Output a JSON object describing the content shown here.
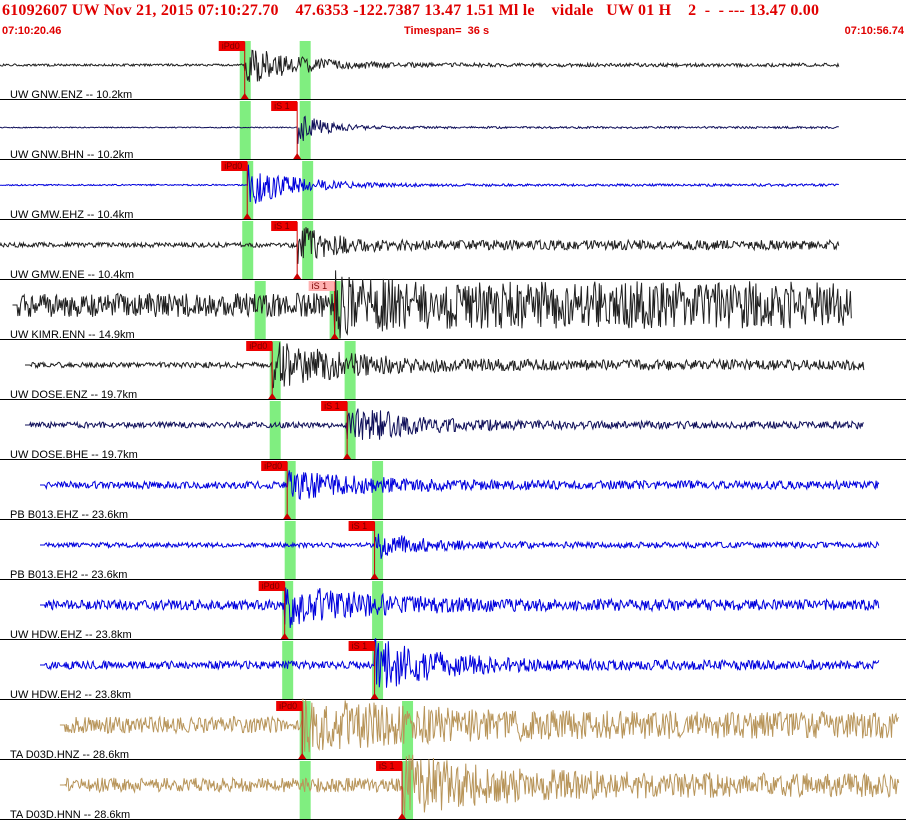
{
  "header": {
    "title": "61092607 UW Nov 21, 2015 07:10:27.70    47.6353 -122.7387 13.47 1.51 Ml le    vidale   UW 01 H    2  -  - --- 13.47 0.00",
    "start_time": "07:10:20.46",
    "timespan": "Timespan=  36 s",
    "end_time": "07:10:56.74"
  },
  "colors": {
    "header_text": "#e00000",
    "pick_flag": "#ee0000",
    "pick_flag_light": "#ffb0b0",
    "pick_window": "#80ee80",
    "trace_black": "#202020",
    "trace_navy": "#10105a",
    "trace_blue": "#0000dd",
    "trace_tan": "#b8955a"
  },
  "time_axis": {
    "start_s": 0,
    "end_s": 36.28
  },
  "traces": [
    {
      "label": "UW GNW.ENZ -- 10.2km",
      "color": "trace_black",
      "start_s": 0,
      "end_s": 33.6,
      "noise": 0.03,
      "pre_amp": 0.05,
      "amp": 0.9,
      "onset_s": 9.8,
      "decay": 6,
      "gain": 0.18,
      "seed": 1,
      "picks": [
        {
          "label": "iPd0",
          "time_s": 9.8,
          "light": false
        }
      ],
      "windows": [
        9.6,
        12.0
      ]
    },
    {
      "label": "UW GNW.BHN -- 10.2km",
      "color": "trace_navy",
      "start_s": 0,
      "end_s": 33.6,
      "noise": 0.02,
      "pre_amp": 0.02,
      "amp": 0.6,
      "onset_s": 11.9,
      "decay": 3,
      "gain": 0.22,
      "seed": 2,
      "offset": 0.25,
      "picks": [
        {
          "label": "iS 1",
          "time_s": 11.9,
          "light": false
        }
      ],
      "windows": [
        9.6,
        12.0
      ]
    },
    {
      "label": "UW GMW.EHZ -- 10.4km",
      "color": "trace_blue",
      "start_s": 0,
      "end_s": 33.6,
      "noise": 0.02,
      "pre_amp": 0.03,
      "amp": 0.9,
      "onset_s": 9.9,
      "decay": 5,
      "gain": 0.2,
      "seed": 3,
      "picks": [
        {
          "label": "iPd0",
          "time_s": 9.9,
          "light": false
        }
      ],
      "windows": [
        9.7,
        12.1
      ]
    },
    {
      "label": "UW GMW.ENE -- 10.4km",
      "color": "trace_black",
      "start_s": 0,
      "end_s": 33.6,
      "noise": 0.1,
      "pre_amp": 0.1,
      "amp": 0.7,
      "onset_s": 11.9,
      "decay": 4,
      "gain": 0.2,
      "seed": 4,
      "picks": [
        {
          "label": "iS 1",
          "time_s": 11.9,
          "light": false
        }
      ],
      "windows": [
        9.7,
        12.1
      ]
    },
    {
      "label": "UW KIMR.ENN -- 14.9km",
      "color": "trace_black",
      "start_s": 0.5,
      "end_s": 34.1,
      "noise": 0.55,
      "pre_amp": 0.55,
      "amp": 0.6,
      "onset_s": 13.4,
      "decay": 4,
      "gain": 0.18,
      "seed": 5,
      "picks": [
        {
          "label": "iS 1",
          "time_s": 13.4,
          "light": true
        }
      ],
      "windows": [
        10.2,
        13.2
      ]
    },
    {
      "label": "UW DOSE.ENZ -- 19.7km",
      "color": "trace_black",
      "start_s": 1.0,
      "end_s": 34.6,
      "noise": 0.1,
      "pre_amp": 0.1,
      "amp": 0.8,
      "onset_s": 10.9,
      "decay": 8,
      "gain": 0.22,
      "seed": 6,
      "picks": [
        {
          "label": "iPd0",
          "time_s": 10.9,
          "light": false
        }
      ],
      "windows": [
        10.8,
        13.8
      ]
    },
    {
      "label": "UW DOSE.BHE -- 19.7km",
      "color": "trace_navy",
      "start_s": 1.0,
      "end_s": 34.6,
      "noise": 0.03,
      "pre_amp": 0.12,
      "amp": 0.8,
      "onset_s": 13.9,
      "decay": 7,
      "gain": 0.2,
      "seed": 7,
      "picks": [
        {
          "label": "iS 1",
          "time_s": 13.9,
          "light": false
        }
      ],
      "windows": [
        10.8,
        13.8
      ]
    },
    {
      "label": "PB B013.EHZ -- 23.6km",
      "color": "trace_blue",
      "start_s": 1.6,
      "end_s": 35.2,
      "noise": 0.03,
      "pre_amp": 0.15,
      "amp": 0.5,
      "onset_s": 11.5,
      "decay": 9,
      "gain": 0.2,
      "seed": 8,
      "picks": [
        {
          "label": "iPd0",
          "time_s": 11.5,
          "light": false
        }
      ],
      "windows": [
        11.4,
        14.9
      ]
    },
    {
      "label": "PB B013.EH2 -- 23.6km",
      "color": "trace_blue",
      "start_s": 1.6,
      "end_s": 35.2,
      "noise": 0.02,
      "pre_amp": 0.1,
      "amp": 0.6,
      "onset_s": 15.0,
      "decay": 5,
      "gain": 0.2,
      "seed": 9,
      "picks": [
        {
          "label": "iS 1",
          "time_s": 15.0,
          "light": false
        }
      ],
      "windows": [
        11.4,
        14.9
      ]
    },
    {
      "label": "UW HDW.EHZ -- 23.8km",
      "color": "trace_blue",
      "start_s": 1.6,
      "end_s": 35.2,
      "noise": 0.03,
      "pre_amp": 0.2,
      "amp": 0.8,
      "onset_s": 11.4,
      "decay": 9,
      "gain": 0.2,
      "seed": 10,
      "picks": [
        {
          "label": "iPd0",
          "time_s": 11.4,
          "light": false
        }
      ],
      "windows": [
        11.3,
        14.9
      ]
    },
    {
      "label": "UW HDW.EH2 -- 23.8km",
      "color": "trace_blue",
      "start_s": 1.6,
      "end_s": 35.2,
      "noise": 0.03,
      "pre_amp": 0.15,
      "amp": 1.0,
      "onset_s": 15.0,
      "decay": 7,
      "gain": 0.22,
      "seed": 11,
      "picks": [
        {
          "label": "iS 1",
          "time_s": 15.0,
          "light": false
        }
      ],
      "windows": [
        11.3,
        14.9
      ]
    },
    {
      "label": "TA D03D.HNZ -- 28.6km",
      "color": "trace_tan",
      "start_s": 2.4,
      "end_s": 36.0,
      "noise": 0.2,
      "pre_amp": 0.35,
      "amp": 0.7,
      "onset_s": 12.1,
      "decay": 14,
      "gain": 0.2,
      "seed": 12,
      "picks": [
        {
          "label": "iPd0",
          "time_s": 12.1,
          "light": false
        }
      ],
      "windows": [
        12.0,
        16.1
      ]
    },
    {
      "label": "TA D03D.HNN -- 28.6km",
      "color": "trace_tan",
      "start_s": 2.4,
      "end_s": 36.0,
      "noise": 0.2,
      "pre_amp": 0.3,
      "amp": 0.9,
      "onset_s": 16.1,
      "decay": 10,
      "gain": 0.2,
      "seed": 13,
      "picks": [
        {
          "label": "iS 1",
          "time_s": 16.1,
          "light": false
        }
      ],
      "windows": [
        12.0,
        16.1
      ]
    }
  ]
}
